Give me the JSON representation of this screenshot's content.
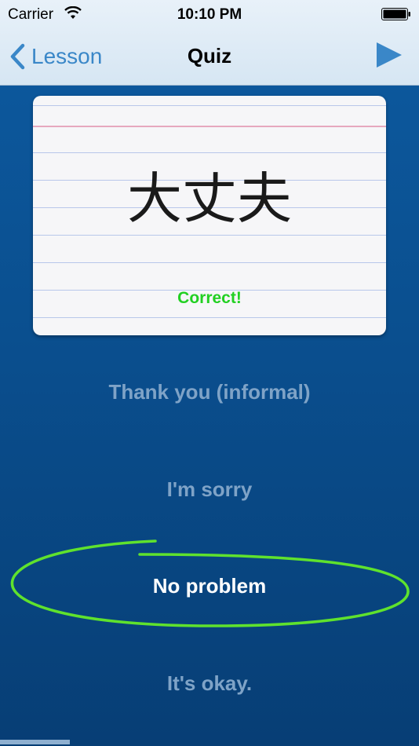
{
  "status_bar": {
    "carrier": "Carrier",
    "time": "10:10 PM",
    "wifi_icon": "wifi-icon",
    "battery_icon": "battery-icon"
  },
  "nav": {
    "back_label": "Lesson",
    "back_icon": "chevron-left-icon",
    "title": "Quiz",
    "play_icon": "play-icon"
  },
  "card": {
    "term": "大丈夫",
    "feedback": "Correct!"
  },
  "options": [
    {
      "label": "Thank you (informal)",
      "selected": false
    },
    {
      "label": "I'm sorry",
      "selected": false
    },
    {
      "label": "No problem",
      "selected": true
    },
    {
      "label": "It's okay.",
      "selected": false
    }
  ],
  "colors": {
    "accent": "#3a87c8",
    "background": "#0a4f8f",
    "correct": "#22d022",
    "circle": "#5fe22d",
    "dim_text": "#7fa3c7"
  }
}
